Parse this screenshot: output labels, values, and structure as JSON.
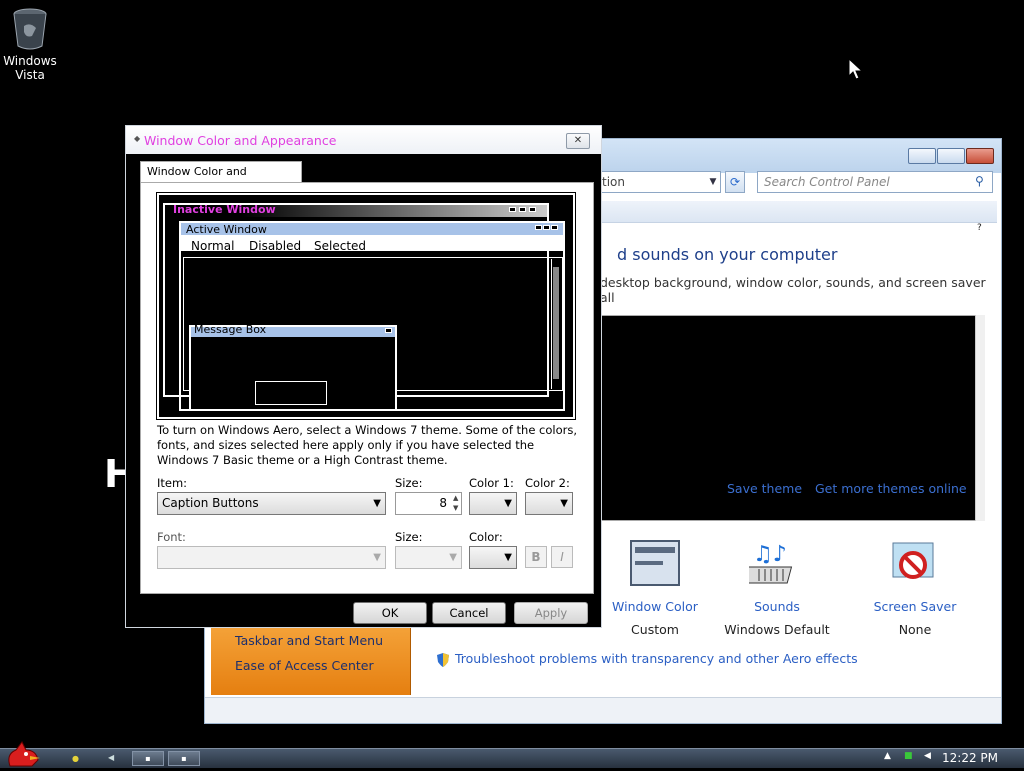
{
  "desktop": {
    "icon_label_line1": "Windows",
    "icon_label_line2": "Vista",
    "stray_glyph": "H"
  },
  "control_panel": {
    "address_fragment": "tion",
    "search_placeholder": "Search Control Panel",
    "help_glyph": "?",
    "heading": "d sounds on your computer",
    "subheading": "desktop background, window color, sounds, and screen saver all",
    "save_theme": "Save theme",
    "more_themes": "Get more themes online",
    "items": [
      {
        "label": "Window Color",
        "value": "Custom"
      },
      {
        "label": "Sounds",
        "value": "Windows Default"
      },
      {
        "label": "Screen Saver",
        "value": "None"
      }
    ],
    "sidebar": {
      "taskbar": "Taskbar and Start Menu",
      "ease": "Ease of Access Center"
    },
    "troubleshoot": "Troubleshoot problems with transparency and other Aero effects"
  },
  "dialog": {
    "title": "Window Color and Appearance",
    "close_glyph": "✕",
    "tab_label": "Window Color and Appearance",
    "preview": {
      "inactive_window": "Inactive Window",
      "active_window": "Active Window",
      "menu_normal": "Normal",
      "menu_disabled": "Disabled",
      "menu_selected": "Selected",
      "message_box": "Message Box"
    },
    "info_text": "To turn on Windows Aero, select a Windows 7 theme.  Some of the colors, fonts, and sizes selected here apply only if you have selected the Windows 7 Basic theme or a High Contrast theme.",
    "labels": {
      "item": "Item:",
      "size": "Size:",
      "color1": "Color 1:",
      "color2": "Color 2:",
      "font": "Font:",
      "font_size": "Size:",
      "font_color": "Color:"
    },
    "item_value": "Caption Buttons",
    "size_value": "8",
    "bold_label": "B",
    "italic_label": "I",
    "buttons": {
      "ok": "OK",
      "cancel": "Cancel",
      "apply": "Apply"
    }
  },
  "taskbar": {
    "clock": "12:22 PM",
    "tray_up": "▲"
  }
}
